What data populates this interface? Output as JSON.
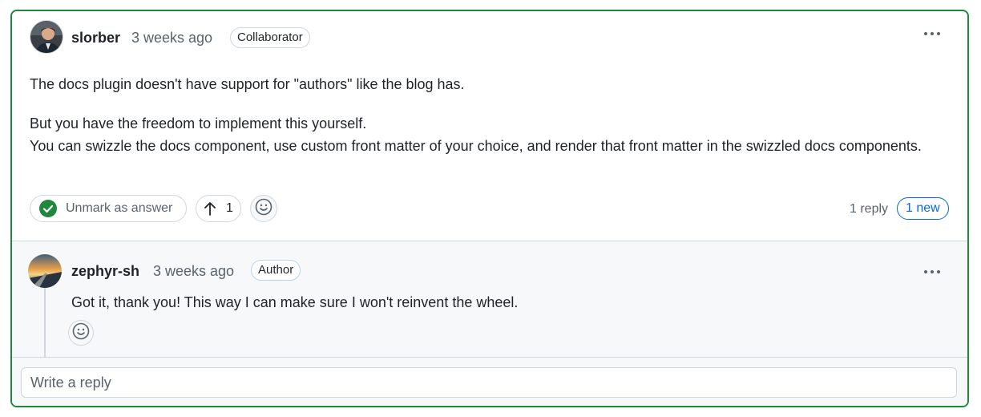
{
  "comment": {
    "username": "slorber",
    "timestamp": "3 weeks ago",
    "badge": "Collaborator",
    "paragraph1": "The docs plugin doesn't have support for \"authors\" like the blog has.",
    "paragraph2_line1": "But you have the freedom to implement this yourself.",
    "paragraph2_line2": "You can swizzle the docs component, use custom front matter of your choice, and render that front matter in the swizzled docs components.",
    "answer_label": "Unmark as answer",
    "upvote_count": "1",
    "reply_count": "1 reply",
    "new_badge": "1 new"
  },
  "reply": {
    "username": "zephyr-sh",
    "timestamp": "3 weeks ago",
    "badge": "Author",
    "text": "Got it, thank you! This way I can make sure I won't reinvent the wheel."
  },
  "composer": {
    "placeholder": "Write a reply"
  },
  "colors": {
    "accent_green": "#1f883d",
    "link_blue": "#0969da",
    "muted_text": "#59636e"
  }
}
